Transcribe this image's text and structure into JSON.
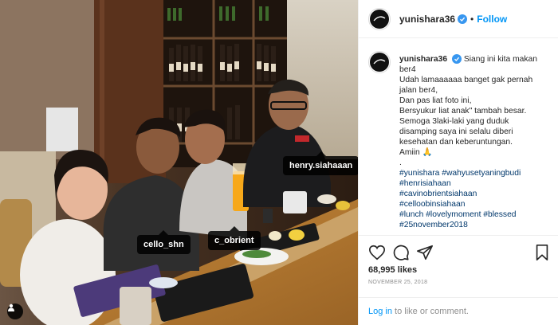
{
  "post": {
    "photo_tags": {
      "cello": "cello_shn",
      "cobrient": "c_obrient",
      "henry": "henry.siahaaan"
    },
    "header": {
      "username": "yunishara36",
      "separator": "•",
      "follow_label": "Follow"
    },
    "caption": {
      "username": "yunishara36",
      "lines": [
        "Siang ini kita makan",
        "ber4",
        "Udah lamaaaaaa banget gak pernah",
        "jalan ber4,",
        "Dan pas liat foto ini,",
        "Bersyukur liat anak\" tambah besar.",
        "Semoga 3laki-laki yang duduk",
        "disamping saya ini selalu diberi",
        "kesehatan dan keberuntungan.",
        "Amiin 🙏",
        "."
      ],
      "hashtags": [
        "#yunishara #wahyusetyaningbudi",
        "#henrisiahaan",
        "#cavinobrientsiahaan",
        "#celloobinsiahaan",
        "#lunch #lovelymoment #blessed",
        "#25november2018"
      ]
    },
    "likes": "68,995 likes",
    "date": "NOVEMBER 25, 2018",
    "login": {
      "link": "Log in",
      "rest": " to like or comment."
    }
  },
  "icons": [
    "heart-icon",
    "comment-icon",
    "share-icon",
    "bookmark-icon",
    "user-tag-icon",
    "verified-icon"
  ],
  "colors": {
    "link": "#0095f6",
    "hashtag": "#00376b",
    "verified": "#3897f0",
    "muted": "#8e8e8e"
  }
}
